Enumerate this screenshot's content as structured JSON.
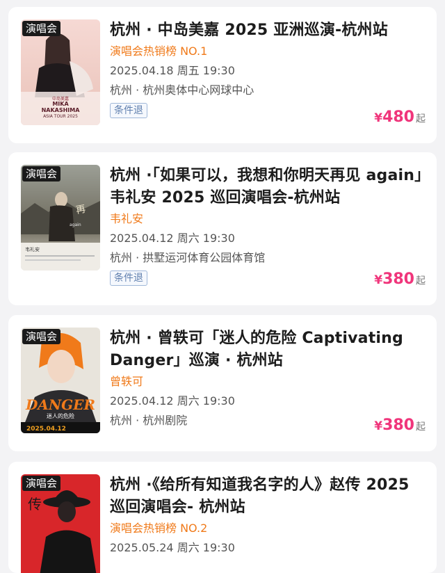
{
  "colors": {
    "accent_orange": "#f07a1a",
    "price_pink": "#f0357b",
    "tag_blue": "#5f7fae"
  },
  "events": [
    {
      "badge": "演唱会",
      "title": "杭州 · 中岛美嘉 2025 亚洲巡演-杭州站",
      "subtitle": "演唱会热销榜 NO.1",
      "datetime": "2025.04.18 周五 19:30",
      "venue": "杭州 · 杭州奥体中心网球中心",
      "tag": "条件退",
      "price_symbol": "¥",
      "price": "480",
      "price_suffix": "起",
      "poster_text": [
        "MIKA",
        "NAKASHIMA",
        "ASIA TOUR 2025"
      ]
    },
    {
      "badge": "演唱会",
      "title": "杭州 ·「如果可以，我想和你明天再见 again」韦礼安 2025 巡回演唱会-杭州站",
      "subtitle": "韦礼安",
      "datetime": "2025.04.12 周六 19:30",
      "venue": "杭州 · 拱墅运河体育公园体育馆",
      "tag": "条件退",
      "price_symbol": "¥",
      "price": "380",
      "price_suffix": "起",
      "poster_text": [
        "韦礼安",
        "again"
      ]
    },
    {
      "badge": "演唱会",
      "title": "杭州 · 曾轶可「迷人的危险 Captivating Danger」巡演 · 杭州站",
      "subtitle": "曾轶可",
      "datetime": "2025.04.12 周六 19:30",
      "venue": "杭州 · 杭州剧院",
      "tag": "",
      "price_symbol": "¥",
      "price": "380",
      "price_suffix": "起",
      "poster_text": [
        "DANGER",
        "迷人的危险",
        "2025.04.12"
      ]
    },
    {
      "badge": "演唱会",
      "title": "杭州 ·《给所有知道我名字的人》赵传 2025 巡回演唱会- 杭州站",
      "subtitle": "演唱会热销榜 NO.2",
      "datetime": "2025.05.24 周六 19:30",
      "venue": "",
      "tag": "",
      "price_symbol": "",
      "price": "",
      "price_suffix": "",
      "poster_text": [
        "传"
      ]
    }
  ]
}
